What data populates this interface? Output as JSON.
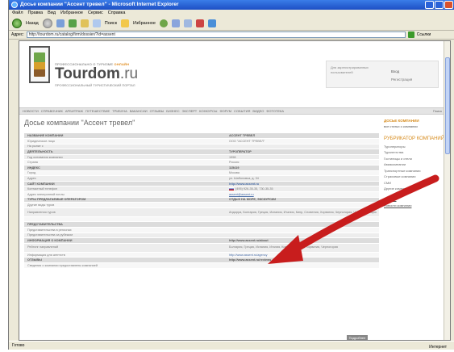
{
  "window": {
    "title": "Досье компании \"Ассент тревел\" - Microsoft Internet Explorer",
    "menu": [
      "Файл",
      "Правка",
      "Вид",
      "Избранное",
      "Сервис",
      "Справка"
    ],
    "toolbar": {
      "back": "Назад",
      "search": "Поиск",
      "favorites": "Избранное"
    },
    "address": "http://tourdom.ru/catalog/firm/dossier/?id=assent",
    "links": "Ссылки",
    "status_left": "Готово",
    "status_zone": "Интернет"
  },
  "site": {
    "tagline_prefix": "ПРОФЕССИОНАЛЬНО О ТУРИЗМЕ",
    "tagline_accent": "ОНЛАЙН",
    "logo": "Tourdom",
    "logo_suffix": ".ru",
    "logo_sub": "ПРОФЕССИОНАЛЬНЫЙ ТУРИСТИЧЕСКИЙ ПОРТАЛ",
    "login_label": "Для зарегистрированных пользователей",
    "login_r1": "Вход",
    "login_r2": "Регистрация",
    "nav": [
      "НОВОСТИ",
      "СПРАВОЧНИК",
      "АРБИТРАЖ",
      "ПУТЕШЕСТВИЕ",
      "ТРИБУНА",
      "ВАКАНСИИ",
      "ОТЗЫВЫ",
      "БИЗНЕС",
      "ЭКСПЕРТ",
      "КОНКУРСЫ",
      "ФОРУМ",
      "СОБЫТИЯ",
      "ВИДЕО",
      "ФОТОТЕКА"
    ],
    "nav_search": "Поиск"
  },
  "page": {
    "title": "Досье компании \"Ассент тревел\""
  },
  "rows": [
    {
      "label": "НАЗВАНИЕ КОМПАНИИ",
      "value": "АССЕНТ ТРЕВЕЛ",
      "section": true
    },
    {
      "label": "Юридическое лицо",
      "value": "ООО \"АССЕНТ ТРЕВЕЛ\""
    },
    {
      "label": "На рынке с",
      "value": ""
    },
    {
      "label": "ДЕЯТЕЛЬНОСТЬ",
      "value": "ТУРОПЕРАТОР",
      "section": true
    },
    {
      "label": "Год основания компании",
      "value": "1998"
    },
    {
      "label": "Страна",
      "value": "Россия"
    },
    {
      "label": "ИНДЕКС",
      "value": "115419",
      "section": true
    },
    {
      "label": "Город",
      "value": "Москва"
    },
    {
      "label": "Адрес",
      "value": "ул. Шаболовка, д. 34"
    },
    {
      "label": "САЙТ КОМПАНИИ",
      "value": "http://www.assent.ru",
      "section": true,
      "link": true
    },
    {
      "label": "Контактный телефон",
      "value": "(495) 926-35-35, 730-35-35",
      "flag": true
    },
    {
      "label": "Адрес электронной почты",
      "value": "assent@assent.ru",
      "link": true
    },
    {
      "label": "ТУРЫ ПРЕДЛАГАЕМЫЕ ОПЕРАТОРОМ",
      "value": "ОТДЫХ НА МОРЕ, ЭКСКУРСИИ",
      "section": true
    },
    {
      "label": "Другие виды туров",
      "value": ""
    },
    {
      "label": "Направления туров",
      "value": "Андорра, Болгария, Греция, Испания, Италия, Кипр, Словения, Хорватия, Черногория, Чехия, Франция",
      "tall": true
    },
    {
      "label": "",
      "value": ""
    },
    {
      "label": "ПРЕДСТАВИТЕЛЬСТВА",
      "value": "",
      "section": true
    },
    {
      "label": "Представительства в регионах",
      "value": ""
    },
    {
      "label": "Представительства за рубежом",
      "value": ""
    },
    {
      "label": "ИНФОРМАЦИЯ О КОМПАНИИ",
      "value": "http://www.assent.ru/about",
      "section": true
    },
    {
      "label": "Рейтинг направлений",
      "value": "Болгария, Греция, Испания, Италия, Кипр, Словения, Хорватия, Черногория",
      "tall": true
    },
    {
      "label": "Информация для агентств",
      "value": "http://www.assent.ru/agency",
      "link": true
    },
    {
      "label": "ОТЗЫВЫ",
      "value": "http://www.assent.ru/reviews",
      "section": true
    },
    {
      "label": "Сведения о компании предоставлены компанией",
      "value": ""
    }
  ],
  "sidebar": {
    "h1": "ДОСЬЕ КОМПАНИИ",
    "h1_link": "все статьи о компании",
    "h2": "РУБРИКАТОР КОМПАНИЙ",
    "list": [
      "Туроператоры",
      "Турагентства",
      "Гостиницы и отели",
      "Авиакомпании",
      "Транспортные компании",
      "Страховые компании",
      "СМИ",
      "Другие компании"
    ],
    "news_h": "Новости",
    "news_link": "Новости компании"
  },
  "more_button": "Подробнее"
}
